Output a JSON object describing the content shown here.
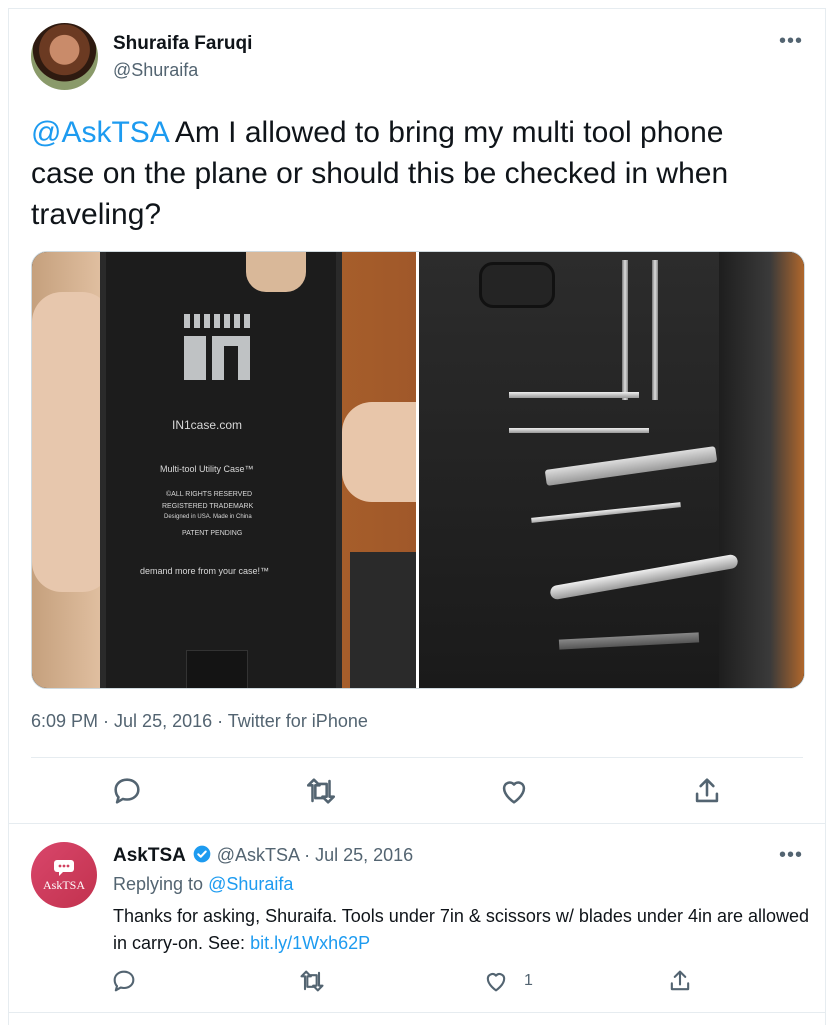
{
  "tweet": {
    "author_name": "Shuraifa Faruqi",
    "author_handle": "@Shuraifa",
    "more_label": "•••",
    "mention": "@AskTSA",
    "text": " Am I allowed to bring my multi tool phone case on the plane or should this be checked in when traveling?",
    "case_print": {
      "site": "IN1case.com",
      "product": "Multi-tool Utility Case™",
      "rights": "©ALL RIGHTS RESERVED",
      "trademark": "REGISTERED TRADEMARK",
      "origin": "Designed in USA. Made in China",
      "patent": "PATENT PENDING",
      "slogan": "demand more from your case!™"
    },
    "time": "6:09 PM",
    "date": "Jul 25, 2016",
    "source": "Twitter for iPhone",
    "meta_sep": " · "
  },
  "reply": {
    "avatar_text": "AskTSA",
    "author_name": "AskTSA",
    "author_handle": "@AskTSA",
    "date": "Jul 25, 2016",
    "dot": " · ",
    "replying_label": "Replying to",
    "replying_handle": "@Shuraifa",
    "text_before_link": "Thanks for asking, Shuraifa. Tools under 7in & scissors w/ blades under 4in are allowed in carry-on. See: ",
    "link": "bit.ly/1Wxh62P",
    "like_count": "1",
    "more_label": "•••"
  },
  "colors": {
    "accent": "#1d9bf0",
    "secondary_text": "#536471",
    "verified": "#1d9bf0",
    "asktsa_brand": "#d2405f"
  },
  "icons": [
    "reply-icon",
    "retweet-icon",
    "like-icon",
    "share-icon",
    "verified-icon",
    "more-icon"
  ]
}
